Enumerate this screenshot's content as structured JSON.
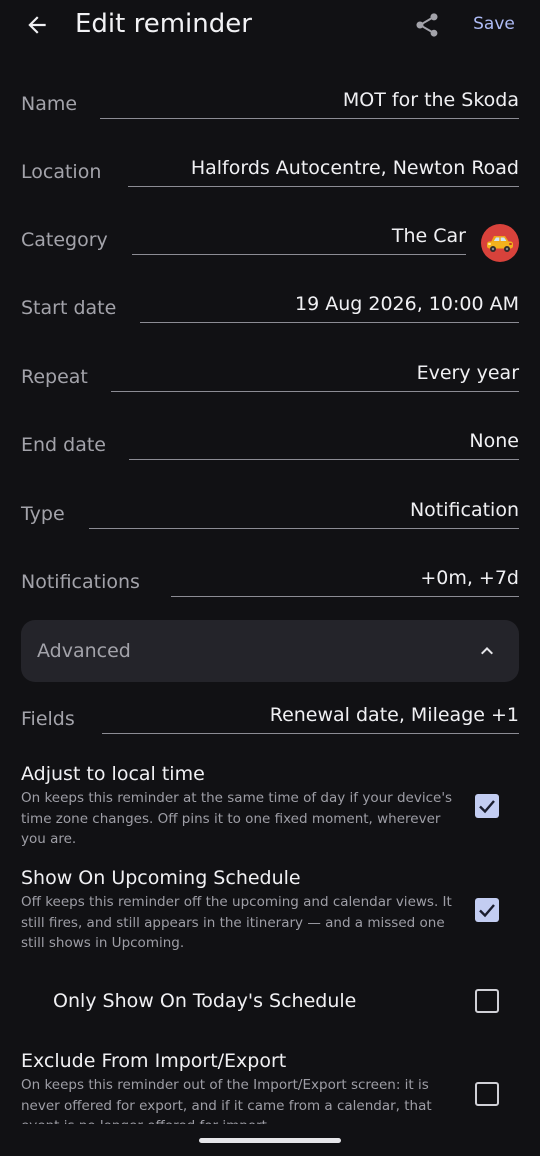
{
  "header": {
    "title": "Edit reminder",
    "save_label": "Save",
    "back_icon": "arrow-left-icon",
    "share_icon": "share-icon"
  },
  "fields": {
    "name": {
      "label": "Name",
      "value": "MOT for the Skoda"
    },
    "location": {
      "label": "Location",
      "value": "Halfords Autocentre, Newton Road"
    },
    "category": {
      "label": "Category",
      "value": "The Car",
      "icon": "car-icon",
      "icon_color": "#d8423b"
    },
    "start_date": {
      "label": "Start date",
      "value": "19 Aug 2026, 10:00 AM"
    },
    "repeat": {
      "label": "Repeat",
      "value": "Every year"
    },
    "end_date": {
      "label": "End date",
      "value": "None"
    },
    "type": {
      "label": "Type",
      "value": "Notification"
    },
    "notifications": {
      "label": "Notifications",
      "value": "+0m, +7d"
    }
  },
  "advanced": {
    "label": "Advanced",
    "expanded": true,
    "chevron_icon": "chevron-up-icon",
    "fields": {
      "label": "Fields",
      "value": "Renewal date, Mileage +1"
    },
    "adjust_local_time": {
      "title": "Adjust to local time",
      "description": "On keeps this reminder at the same time of day if your device's time zone changes. Off pins it to one fixed moment, wherever you are.",
      "checked": true
    },
    "show_upcoming": {
      "title": "Show On Upcoming Schedule",
      "description": "Off keeps this reminder off the upcoming and calendar views. It still fires, and still appears in the itinerary — and a missed one still shows in Upcoming.",
      "checked": true
    },
    "only_today": {
      "title": "Only Show On Today's Schedule",
      "checked": false
    },
    "exclude_import_export": {
      "title": "Exclude From Import/Export",
      "description": "On keeps this reminder out of the Import/Export screen: it is never offered for export, and if it came from a calendar, that event is no longer offered for import.",
      "checked": false
    }
  },
  "colors": {
    "background": "#111114",
    "accent": "#aebbf5",
    "checkbox_checked": "#c3cdf2",
    "panel": "#24242a"
  }
}
